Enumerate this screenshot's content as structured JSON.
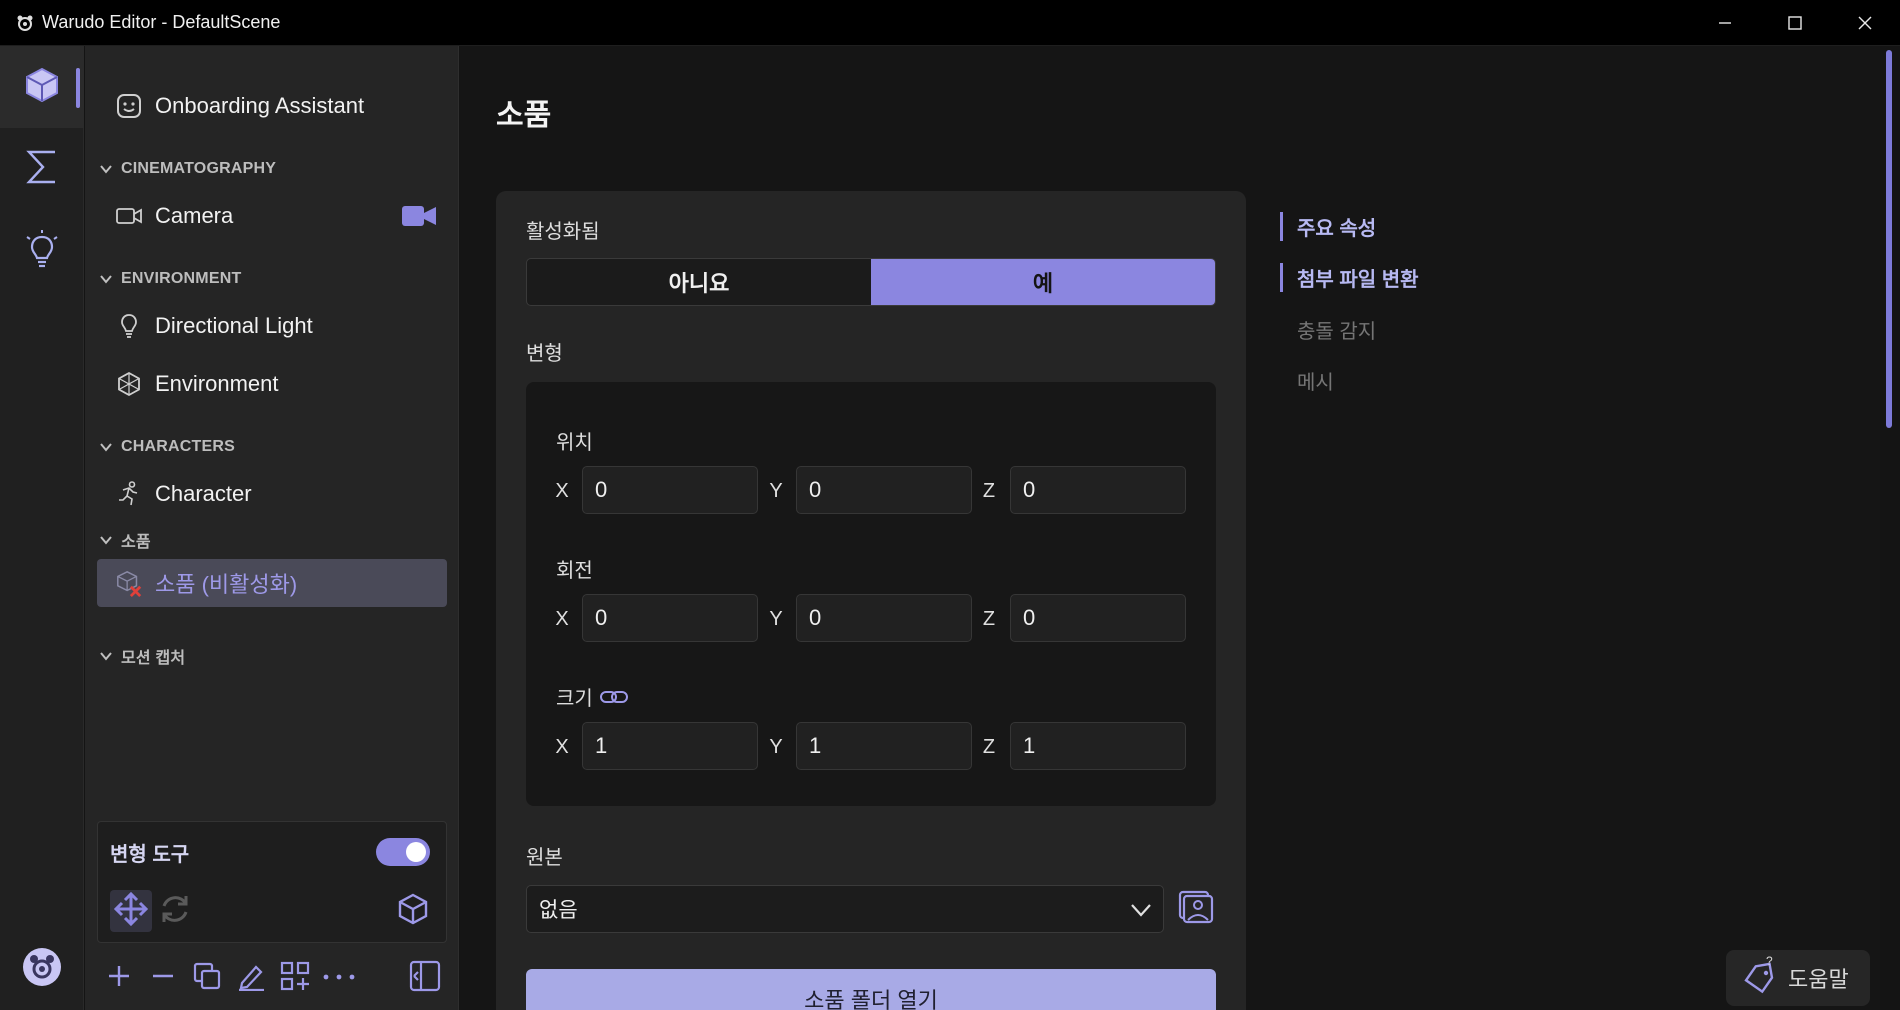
{
  "window": {
    "title": "Warudo Editor - DefaultScene",
    "minimize_glyph": "─",
    "maximize_glyph": "☐",
    "close_glyph": "✕"
  },
  "rail": {
    "items": [
      {
        "name": "scene-cube-icon",
        "active": true
      },
      {
        "name": "sigma-icon",
        "active": false
      },
      {
        "name": "lightbulb-icon",
        "active": false
      }
    ]
  },
  "sidebar": {
    "onboarding_label": "Onboarding Assistant",
    "sections": [
      {
        "label": "CINEMATOGRAPHY",
        "items": [
          "Camera"
        ]
      },
      {
        "label": "ENVIRONMENT",
        "items": [
          "Directional Light",
          "Environment"
        ]
      },
      {
        "label": "CHARACTERS",
        "items": [
          "Character"
        ]
      },
      {
        "label": "소품",
        "items": [
          "소품 (비활성화)"
        ]
      },
      {
        "label": "모션 캡처",
        "items": []
      }
    ]
  },
  "tool_panel": {
    "title": "변형 도구",
    "enabled": true
  },
  "main": {
    "page_title": "소품",
    "enabled_label": "활성화됨",
    "enabled_options": [
      "아니요",
      "예"
    ],
    "enabled_selected": "예",
    "transform_label": "변형",
    "position_label": "위치",
    "rotation_label": "회전",
    "scale_label": "크기",
    "axis_labels": [
      "X",
      "Y",
      "Z"
    ],
    "position": [
      "0",
      "0",
      "0"
    ],
    "rotation": [
      "0",
      "0",
      "0"
    ],
    "scale": [
      "1",
      "1",
      "1"
    ],
    "source_label": "원본",
    "source_value": "없음",
    "open_folder_label": "소품 폴더 열기"
  },
  "right_nav": {
    "anchors": [
      {
        "label": "주요 속성",
        "active": true
      },
      {
        "label": "첨부 파일 변환",
        "active": true
      },
      {
        "label": "충돌 감지",
        "active": false
      },
      {
        "label": "메시",
        "active": false
      }
    ]
  },
  "help": {
    "label": "도움말"
  },
  "colors": {
    "accent": "#8b86e0",
    "button_light": "#a8aae6",
    "background": "#151515",
    "card": "#252525"
  }
}
